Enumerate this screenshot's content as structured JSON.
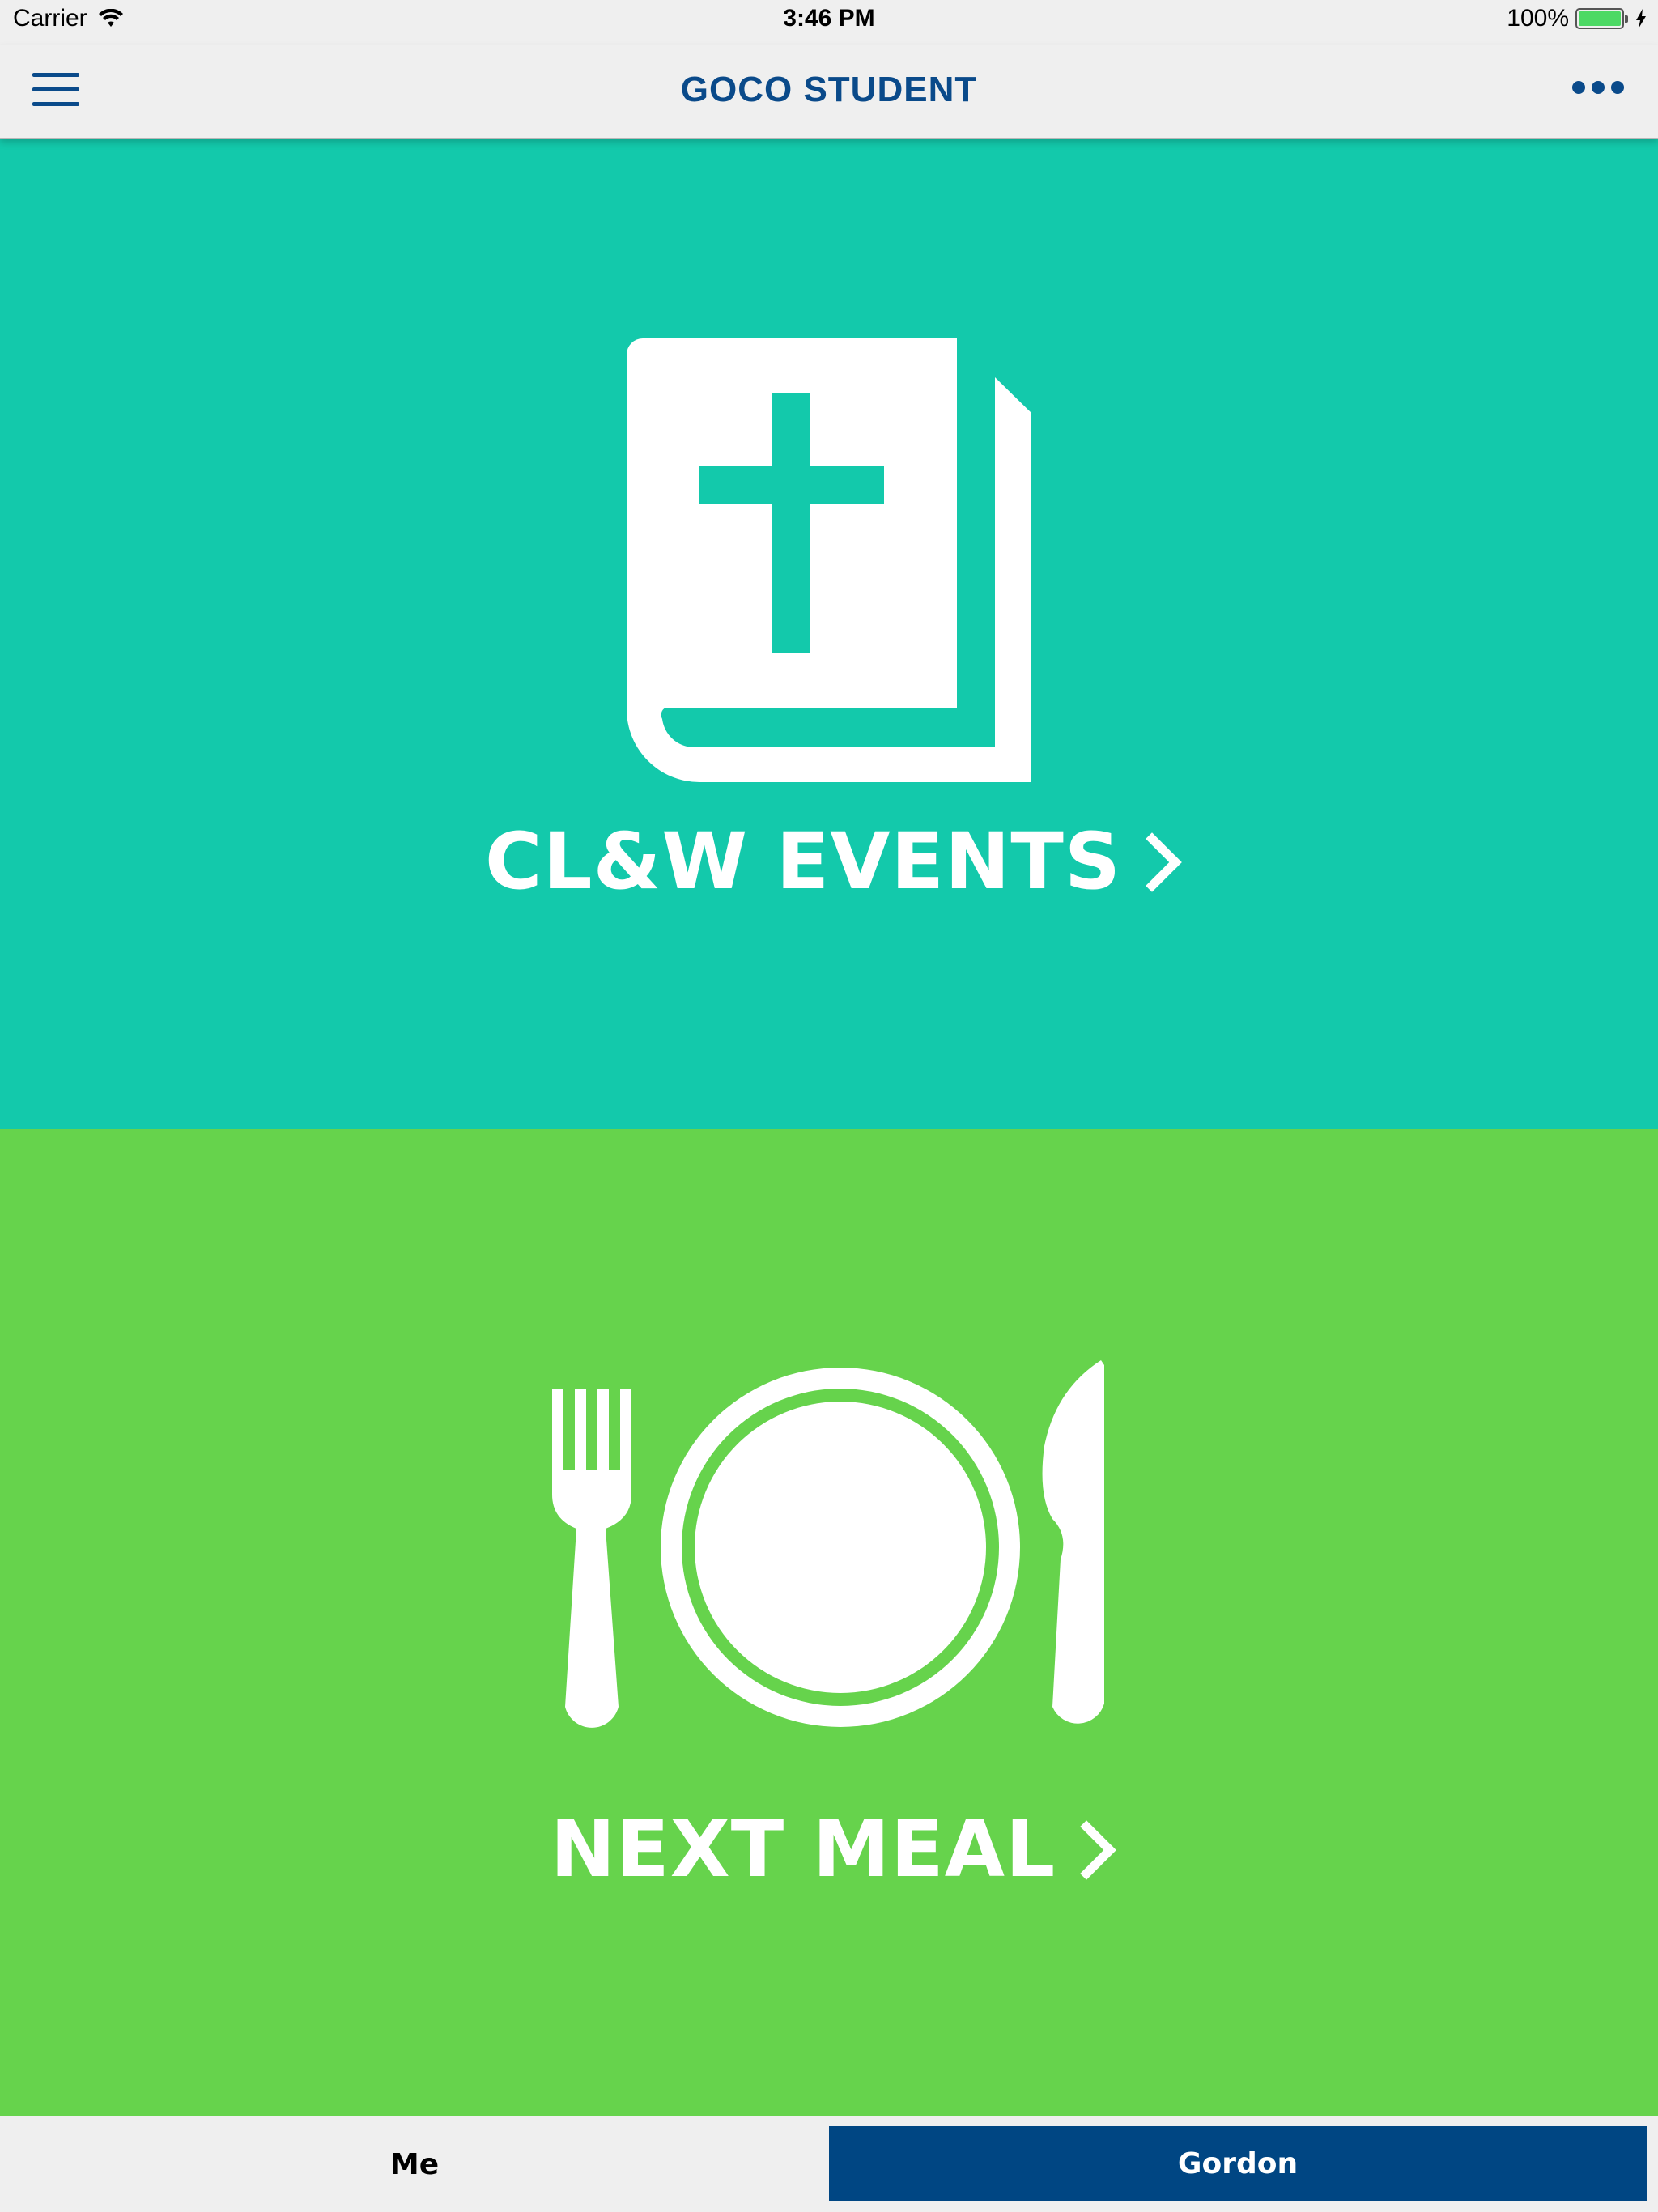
{
  "status_bar": {
    "carrier": "Carrier",
    "time": "3:46 PM",
    "battery": "100%",
    "battery_level": 1.0,
    "icons": [
      "wifi-icon",
      "battery-icon",
      "charging-icon"
    ]
  },
  "nav": {
    "title": "GOCO STUDENT",
    "menu_icon": "hamburger-menu-icon",
    "more_icon": "ellipsis-icon"
  },
  "tiles": [
    {
      "label": "CL&W EVENTS",
      "icon": "bible-icon",
      "color": "#13c9ab"
    },
    {
      "label": "NEXT MEAL",
      "icon": "plate-fork-knife-icon",
      "color": "#66d34c"
    }
  ],
  "tabs": [
    {
      "label": "Me",
      "selected": false
    },
    {
      "label": "Gordon",
      "selected": true
    }
  ],
  "colors": {
    "brand_blue": "#0a4a8a",
    "tab_selected": "#004683"
  }
}
